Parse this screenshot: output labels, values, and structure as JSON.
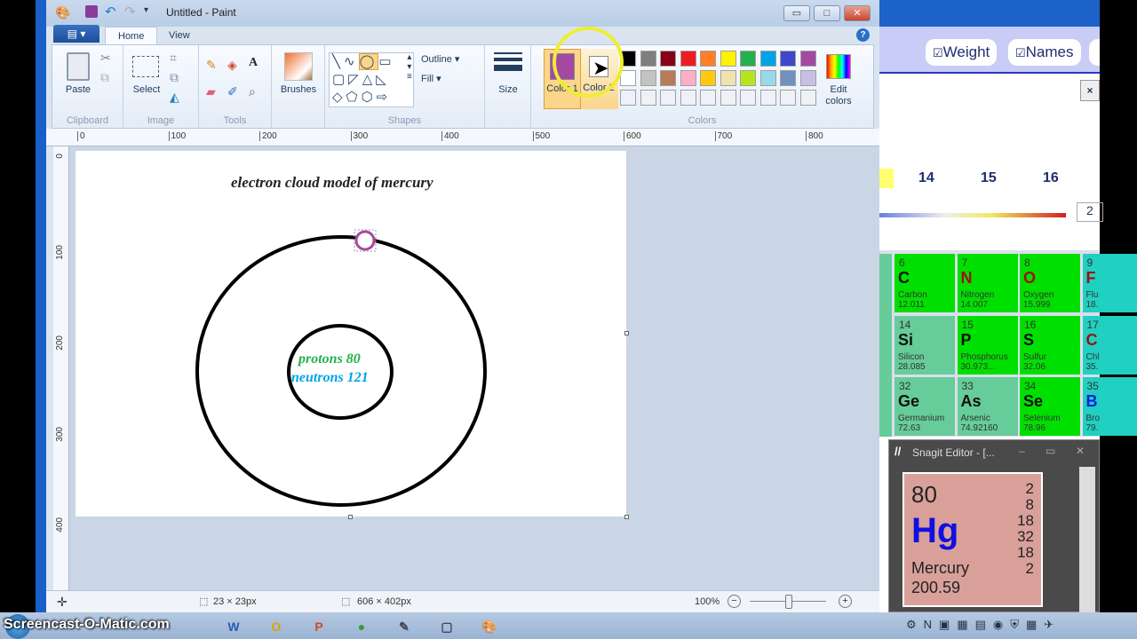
{
  "window": {
    "title": "Untitled - Paint",
    "minimize": "▭",
    "maximize": "□",
    "close": "✕"
  },
  "tabs": [
    {
      "label": "Home"
    },
    {
      "label": "View"
    }
  ],
  "file_menu": "▤ ▾",
  "help": "?",
  "ribbon": {
    "clipboard": {
      "group": "Clipboard",
      "paste": "Paste"
    },
    "image": {
      "group": "Image",
      "select": "Select"
    },
    "tools": {
      "group": "Tools"
    },
    "brushes": {
      "label": "Brushes"
    },
    "shapes": {
      "group": "Shapes",
      "outline": "Outline ▾",
      "fill": "Fill ▾"
    },
    "size": {
      "label": "Size"
    },
    "colors": {
      "group": "Colors",
      "color1": "Color 1",
      "color2": "Color 2",
      "edit": "Edit colors",
      "color1_value": "#a349a4",
      "color2_value": "#ffffff",
      "palette_row1": [
        "#000000",
        "#7f7f7f",
        "#880015",
        "#ed1c24",
        "#ff7f27",
        "#fff200",
        "#22b14c",
        "#00a2e8",
        "#3f48cc",
        "#a349a4"
      ],
      "palette_row2": [
        "#ffffff",
        "#c3c3c3",
        "#b97a57",
        "#ffaec9",
        "#ffc90e",
        "#efe4b0",
        "#b5e61d",
        "#99d9ea",
        "#7092be",
        "#c8bfe7"
      ]
    }
  },
  "ruler": {
    "h": [
      "0",
      "100",
      "200",
      "300",
      "400",
      "500",
      "600",
      "700",
      "800"
    ],
    "v": [
      "0",
      "100",
      "200",
      "300",
      "400"
    ]
  },
  "canvas": {
    "title": "electron cloud model of mercury",
    "protons": "protons 80",
    "neutrons": "neutrons 121",
    "electron_color": "#a349a4",
    "protons_color": "#22b14c",
    "neutrons_color": "#00a2e8"
  },
  "status": {
    "selection": "23 × 23px",
    "canvas_size": "606 × 402px",
    "zoom": "100%",
    "zoom_level": 100
  },
  "browser": {
    "weight": "Weight",
    "names": "Names",
    "close": "×",
    "groups": [
      "14",
      "15",
      "16"
    ],
    "field": "2",
    "elements": [
      {
        "n": "6",
        "s": "C",
        "name": "Carbon",
        "w": "12.011",
        "bg": "#00e000",
        "sc": "#111"
      },
      {
        "n": "7",
        "s": "N",
        "name": "Nitrogen",
        "w": "14.007",
        "bg": "#00e000",
        "sc": "#a01010"
      },
      {
        "n": "8",
        "s": "O",
        "name": "Oxygen",
        "w": "15.999",
        "bg": "#00e000",
        "sc": "#a01010"
      },
      {
        "n": "9",
        "s": "F",
        "name": "Flu",
        "w": "18.",
        "bg": "#20d0c0",
        "sc": "#a01010"
      },
      {
        "n": "14",
        "s": "Si",
        "name": "Silicon",
        "w": "28.085",
        "bg": "#66cc99",
        "sc": "#111"
      },
      {
        "n": "15",
        "s": "P",
        "name": "Phosphorus",
        "w": "30.973...",
        "bg": "#00e000",
        "sc": "#111"
      },
      {
        "n": "16",
        "s": "S",
        "name": "Sulfur",
        "w": "32.06",
        "bg": "#00e000",
        "sc": "#111"
      },
      {
        "n": "17",
        "s": "C",
        "name": "Chl",
        "w": "35.",
        "bg": "#20d0c0",
        "sc": "#a01010"
      },
      {
        "n": "32",
        "s": "Ge",
        "name": "Germanium",
        "w": "72.63",
        "bg": "#66cc99",
        "sc": "#111"
      },
      {
        "n": "33",
        "s": "As",
        "name": "Arsenic",
        "w": "74.92160",
        "bg": "#66cc99",
        "sc": "#111"
      },
      {
        "n": "34",
        "s": "Se",
        "name": "Selenium",
        "w": "78.96",
        "bg": "#00e000",
        "sc": "#111"
      },
      {
        "n": "35",
        "s": "B",
        "name": "Bro",
        "w": "79.",
        "bg": "#20d0c0",
        "sc": "#1020e0"
      }
    ]
  },
  "snagit": {
    "title": "Snagit Editor - [...",
    "number": "80",
    "symbol": "Hg",
    "name": "Mercury",
    "weight": "200.59",
    "shells": [
      "2",
      "8",
      "18",
      "32",
      "18",
      "2"
    ]
  },
  "watermark": "Screencast-O-Matic.com",
  "taskbar": [
    "W",
    "O",
    "P",
    "●",
    "✎",
    "▢",
    "🎨"
  ]
}
